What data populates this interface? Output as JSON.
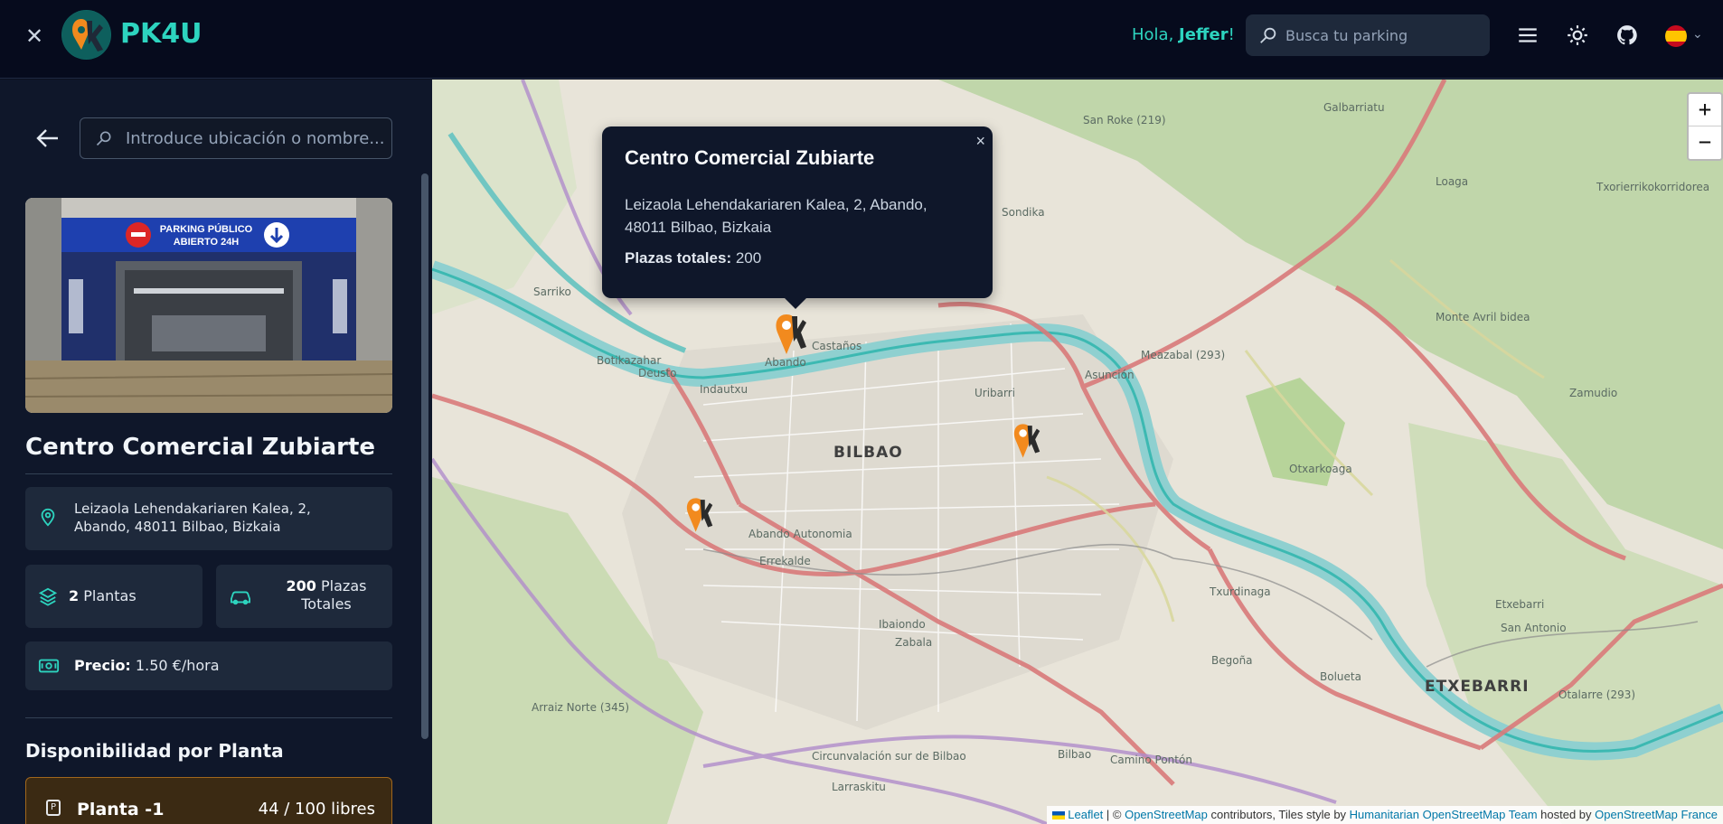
{
  "header": {
    "brand": "PK4U",
    "greeting_prefix": "Hola, ",
    "user_name": "Jeffer",
    "greeting_suffix": "!",
    "search_placeholder": "Busca tu parking",
    "language_flag": "es"
  },
  "sidebar": {
    "location_placeholder": "Introduce ubicación o nombre...",
    "photo_sign_text": "PARKING PÚBLICO ABIERTO 24H",
    "parking_name": "Centro Comercial Zubiarte",
    "address": "Leizaola Lehendakariaren Kalea, 2, Abando, 48011 Bilbao, Bizkaia",
    "plantas_count": "2",
    "plantas_label": "Plantas",
    "plazas_count": "200",
    "plazas_label": "Plazas Totales",
    "precio_label": "Precio:",
    "precio_value": "1.50 €/hora",
    "availability_title": "Disponibilidad por Planta",
    "floors": [
      {
        "icon": "P",
        "label": "Planta -1",
        "available": "44 / 100 libres"
      }
    ]
  },
  "map": {
    "popup": {
      "title": "Centro Comercial Zubiarte",
      "address_line1": "Leizaola Lehendakariaren Kalea, 2, Abando,",
      "address_line2": "48011 Bilbao, Bizkaia",
      "total_label": "Plazas totales:",
      "total_value": "200"
    },
    "zoom_in": "+",
    "zoom_out": "−",
    "city_label": "BILBAO",
    "district_label": "ETXEBARRI",
    "labels": [
      "Abando",
      "Castaños",
      "Uribarri",
      "Asunción",
      "Deusto",
      "Botikazahar",
      "Indautxu",
      "Sarriko",
      "Abando Autonomia",
      "Errekalde",
      "Zabala",
      "San Roke (219)",
      "Galbarriatu",
      "Loaga",
      "Meazabal (293)",
      "San Antonio",
      "Otalarre (293)",
      "Arraiz Norte (345)",
      "Larraskitu",
      "Camino Pontón",
      "Txurdinaga",
      "Otxarkoaga",
      "Circunvalación sur de Bilbao",
      "Ibaiondo",
      "Bolueta",
      "Begoña",
      "Sondika",
      "Zamudio",
      "Monte Avril bidea",
      "Txorierrikokorridorea",
      "Bilbao",
      "Etxebarri"
    ],
    "attribution": {
      "leaflet": "Leaflet",
      "sep": " | © ",
      "osm": "OpenStreetMap",
      "text1": " contributors, Tiles style by ",
      "hot": "Humanitarian OpenStreetMap Team",
      "text2": " hosted by ",
      "osmfr": "OpenStreetMap France"
    }
  },
  "colors": {
    "accent": "#2dd4bf",
    "header_bg": "#060b1d",
    "sidebar_bg": "#0f172a",
    "card_bg": "#1e293b",
    "marker_orange": "#f28a1e",
    "floor_border": "#a1671c"
  }
}
